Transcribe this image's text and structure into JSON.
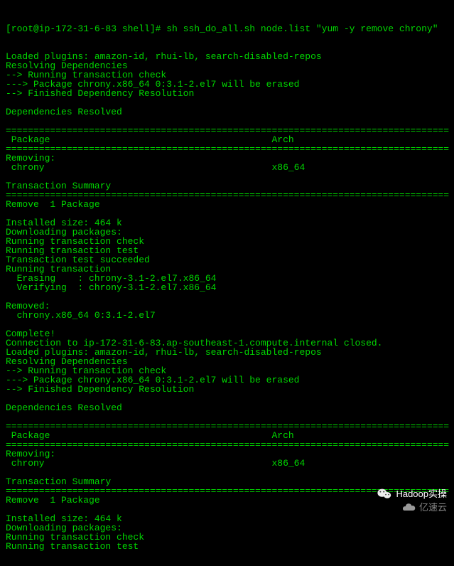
{
  "prompt": "[root@ip-172-31-6-83 shell]# sh ssh_do_all.sh node.list \"yum -y remove chrony\"",
  "lines": [
    "Loaded plugins: amazon-id, rhui-lb, search-disabled-repos",
    "Resolving Dependencies",
    "--> Running transaction check",
    "---> Package chrony.x86_64 0:3.1-2.el7 will be erased",
    "--> Finished Dependency Resolution",
    "",
    "Dependencies Resolved",
    "",
    "================================================================================",
    " Package                                        Arch",
    "================================================================================",
    "Removing:",
    " chrony                                         x86_64",
    "",
    "Transaction Summary",
    "================================================================================",
    "Remove  1 Package",
    "",
    "Installed size: 464 k",
    "Downloading packages:",
    "Running transaction check",
    "Running transaction test",
    "Transaction test succeeded",
    "Running transaction",
    "  Erasing    : chrony-3.1-2.el7.x86_64",
    "  Verifying  : chrony-3.1-2.el7.x86_64",
    "",
    "Removed:",
    "  chrony.x86_64 0:3.1-2.el7",
    "",
    "Complete!",
    "Connection to ip-172-31-6-83.ap-southeast-1.compute.internal closed.",
    "Loaded plugins: amazon-id, rhui-lb, search-disabled-repos",
    "Resolving Dependencies",
    "--> Running transaction check",
    "---> Package chrony.x86_64 0:3.1-2.el7 will be erased",
    "--> Finished Dependency Resolution",
    "",
    "Dependencies Resolved",
    "",
    "================================================================================",
    " Package                                        Arch",
    "================================================================================",
    "Removing:",
    " chrony                                         x86_64",
    "",
    "Transaction Summary",
    "================================================================================",
    "Remove  1 Package",
    "",
    "Installed size: 464 k",
    "Downloading packages:",
    "Running transaction check",
    "Running transaction test"
  ],
  "watermark1": "Hadoop实操",
  "watermark2": "亿速云"
}
